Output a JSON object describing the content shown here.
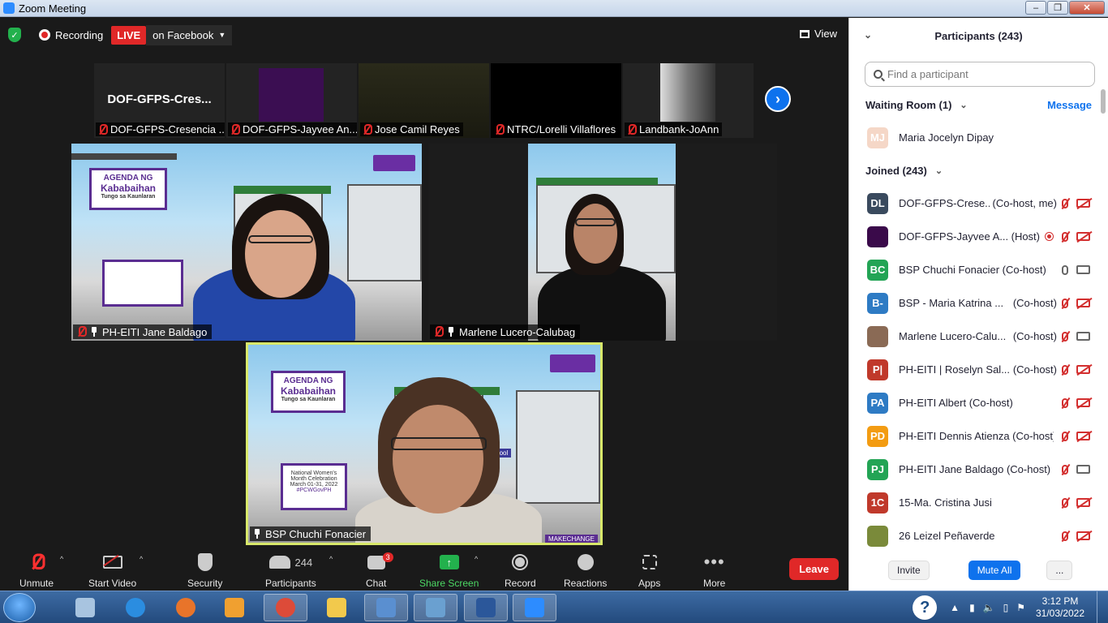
{
  "window": {
    "title": "Zoom Meeting"
  },
  "top_bar": {
    "recording_label": "Recording",
    "live_badge": "LIVE",
    "live_destination": "on Facebook",
    "view_label": "View"
  },
  "thumbnails": [
    {
      "display_name": "DOF-GFPS-Cres...",
      "label": "DOF-GFPS-Cresencia ..."
    },
    {
      "display_name": "",
      "label": "DOF-GFPS-Jayvee An..."
    },
    {
      "display_name": "",
      "label": "Jose Camil Reyes"
    },
    {
      "display_name": "",
      "label": "NTRC/Lorelli Villaflores"
    },
    {
      "display_name": "",
      "label": "Landbank-JoAnn"
    }
  ],
  "videos": {
    "v1": {
      "name": "PH-EITI Jane Baldago",
      "card_line1": "AGENDA NG",
      "card_line2": "Kababaihan",
      "card_line3": "Tungo sa Kaunlaran"
    },
    "v2": {
      "name": "Marlene Lucero-Calubag"
    },
    "v3": {
      "name": "BSP Chuchi Fonacier",
      "card_line1": "AGENDA NG",
      "card_line2": "Kababaihan",
      "card_line3": "Tungo sa Kaunlaran",
      "board_line1": "National Women's",
      "board_line2": "Month Celebration",
      "board_line3": "March 01-31, 2022",
      "board_line4": "#PCWGovPH",
      "school": "lic School",
      "hashtag": "MAKECHANGE"
    }
  },
  "toolbar": {
    "unmute": "Unmute",
    "start_video": "Start Video",
    "security": "Security",
    "participants": "Participants",
    "participants_count": "244",
    "chat": "Chat",
    "chat_badge": "3",
    "share_screen": "Share Screen",
    "record": "Record",
    "reactions": "Reactions",
    "apps": "Apps",
    "more": "More",
    "leave": "Leave"
  },
  "panel": {
    "title": "Participants (243)",
    "search_placeholder": "Find a participant",
    "waiting_room": "Waiting Room (1)",
    "message_label": "Message",
    "waiting": [
      {
        "initials": "MJ",
        "color": "#f5d3c2",
        "name": "Maria Jocelyn Dipay"
      }
    ],
    "joined_label": "Joined (243)",
    "joined": [
      {
        "initials": "DL",
        "color": "#3a4a5e",
        "name": "DOF-GFPS-Crese...",
        "role": "(Co-host, me)",
        "mic": "off",
        "cam": "off"
      },
      {
        "initials": "",
        "color": "#3a0a4a",
        "name": "DOF-GFPS-Jayvee A...",
        "role": "(Host)",
        "mic": "off",
        "cam": "off",
        "rec": true
      },
      {
        "initials": "BC",
        "color": "#23a455",
        "name": "BSP Chuchi Fonacier (Co-host)",
        "role": "",
        "mic": "on",
        "cam": "on"
      },
      {
        "initials": "B-",
        "color": "#2e7bc4",
        "name": "BSP - Maria Katrina ...",
        "role": "(Co-host)",
        "mic": "off",
        "cam": "off"
      },
      {
        "initials": "",
        "color": "#8a6a55",
        "name": "Marlene Lucero-Calu...",
        "role": "(Co-host)",
        "mic": "off",
        "cam": "on"
      },
      {
        "initials": "P|",
        "color": "#c0392b",
        "name": "PH-EITI | Roselyn Sal...",
        "role": "(Co-host)",
        "mic": "off",
        "cam": "off"
      },
      {
        "initials": "PA",
        "color": "#2e7bc4",
        "name": "PH-EITI Albert (Co-host)",
        "role": "",
        "mic": "off",
        "cam": "off"
      },
      {
        "initials": "PD",
        "color": "#f39c12",
        "name": "PH-EITI Dennis Atienza (Co-host)",
        "role": "",
        "mic": "off",
        "cam": "off"
      },
      {
        "initials": "PJ",
        "color": "#23a455",
        "name": "PH-EITI Jane Baldago (Co-host)",
        "role": "",
        "mic": "off",
        "cam": "on"
      },
      {
        "initials": "1C",
        "color": "#c0392b",
        "name": "15-Ma. Cristina Jusi",
        "role": "",
        "mic": "off",
        "cam": "off"
      },
      {
        "initials": "",
        "color": "#7a8a3a",
        "name": "26 Leizel Peñaverde",
        "role": "",
        "mic": "off",
        "cam": "off"
      }
    ],
    "invite_label": "Invite",
    "mute_all_label": "Mute All",
    "more_label": "..."
  },
  "taskbar": {
    "time": "3:12 PM",
    "date": "31/03/2022",
    "apps": [
      "calculator",
      "internet-explorer",
      "firefox",
      "media-player",
      "chrome",
      "file-explorer",
      "remote-desktop",
      "photo-viewer",
      "word",
      "zoom"
    ]
  },
  "colors": {
    "accent": "#0e72ed",
    "live": "#e02828",
    "active_speaker": "#d8e86a",
    "share_green": "#23b14d"
  }
}
